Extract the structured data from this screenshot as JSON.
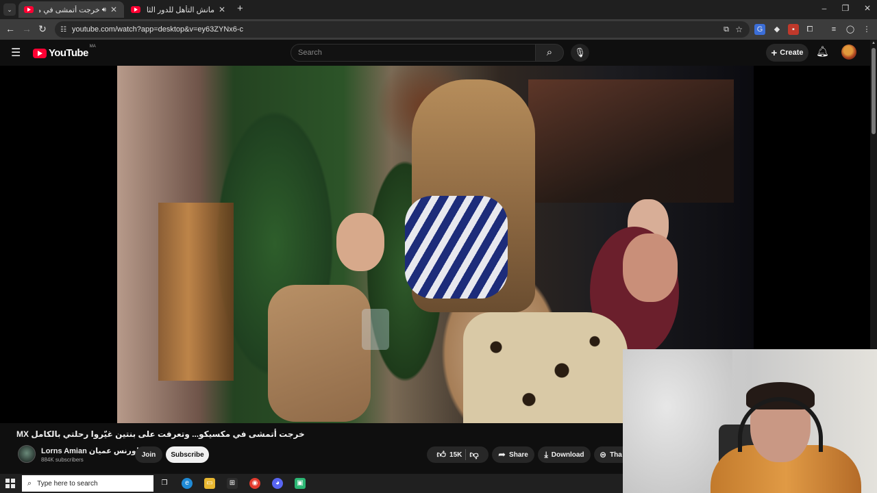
{
  "browser": {
    "tabs": [
      {
        "title": "خرجت أتمشى في مكسيكو...",
        "audio_icon": "speaker-icon"
      },
      {
        "title": "مانش التأهل للدور الثاني؟ التشك..."
      }
    ],
    "new_tab": "+",
    "url": "youtube.com/watch?app=desktop&v=ey63ZYNx6-c",
    "window_controls": [
      "–",
      "❐",
      "✕"
    ]
  },
  "youtube": {
    "logo_text": "YouTube",
    "country_code": "MA",
    "search_placeholder": "Search",
    "create_label": "Create"
  },
  "video": {
    "title": "خرجت أتمشى في مكسيكو... وتعرفت على بنتين غيّروا رحلتي بالكامل MX",
    "channel_name": "Lorns Amian لورنس عميان",
    "subscribers": "884K subscribers",
    "join_label": "Join",
    "subscribe_label": "Subscribe",
    "likes": "15K",
    "share_label": "Share",
    "download_label": "Download",
    "thanks_label": "Tha"
  },
  "taskbar": {
    "search_placeholder": "Type here to search"
  },
  "colors": {
    "yt_red": "#ff0033",
    "background": "#0f0f0f",
    "pill": "#272727"
  }
}
